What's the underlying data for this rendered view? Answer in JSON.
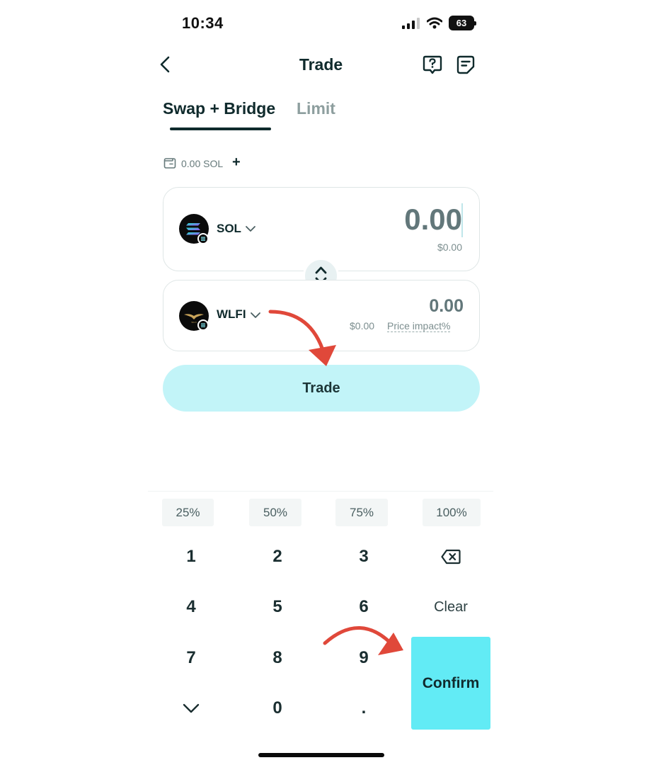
{
  "status_bar": {
    "time": "10:34",
    "battery": "63"
  },
  "header": {
    "title": "Trade"
  },
  "tabs": [
    {
      "label": "Swap + Bridge",
      "active": true
    },
    {
      "label": "Limit",
      "active": false
    }
  ],
  "balance": {
    "text": "0.00 SOL",
    "add_label": "+"
  },
  "from": {
    "token": "SOL",
    "amount": "0.00",
    "usd": "$0.00"
  },
  "to": {
    "token": "WLFI",
    "amount": "0.00",
    "usd": "$0.00",
    "price_impact_label": "Price impact%"
  },
  "trade_button": {
    "label": "Trade"
  },
  "keypad": {
    "percentages": [
      "25%",
      "50%",
      "75%",
      "100%"
    ],
    "keys": [
      "1",
      "2",
      "3",
      "4",
      "5",
      "6",
      "7",
      "8",
      "9",
      ".",
      "0"
    ],
    "clear_label": "Clear",
    "confirm_label": "Confirm"
  },
  "colors": {
    "primary_text": "#0f2a2c",
    "trade_button_bg": "#c2f4f8",
    "confirm_bg": "#62ebf5",
    "annotation_arrow": "#e0483a"
  },
  "icons": {
    "back": "chevron-left-icon",
    "help": "help-chat-icon",
    "notes": "notes-icon",
    "wallet": "wallet-icon",
    "swap": "swap-direction-icon",
    "backspace": "backspace-icon",
    "collapse": "chevron-down-icon"
  }
}
